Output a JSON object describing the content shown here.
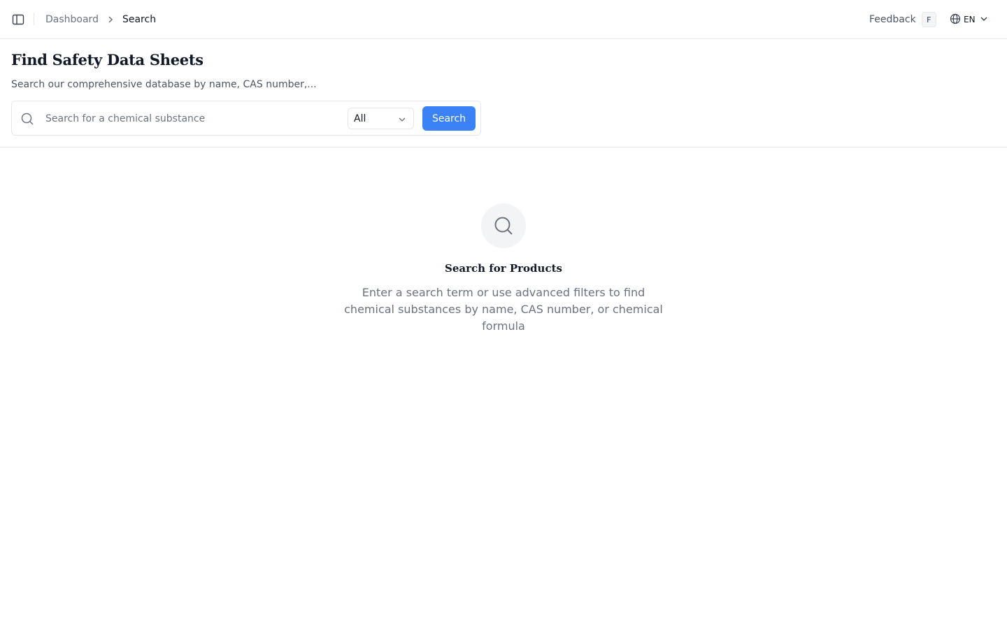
{
  "breadcrumb": {
    "parent": "Dashboard",
    "current": "Search"
  },
  "topbar": {
    "feedback_label": "Feedback",
    "feedback_shortcut": "F",
    "language": "EN"
  },
  "header": {
    "title": "Find Safety Data Sheets",
    "subtitle": "Search our comprehensive database by name, CAS number,..."
  },
  "search": {
    "placeholder": "Search for a chemical substance",
    "value": "",
    "filter_selected": "All",
    "button_label": "Search"
  },
  "empty_state": {
    "title": "Search for Products",
    "description": "Enter a search term or use advanced filters to find chemical substances by name, CAS number, or chemical formula"
  },
  "colors": {
    "accent": "#3b82f6",
    "border": "#e5e7eb",
    "muted_text": "#6b7280"
  },
  "icons": [
    "sidebar-toggle-icon",
    "chevron-right-icon",
    "globe-icon",
    "chevron-down-icon",
    "search-icon"
  ]
}
